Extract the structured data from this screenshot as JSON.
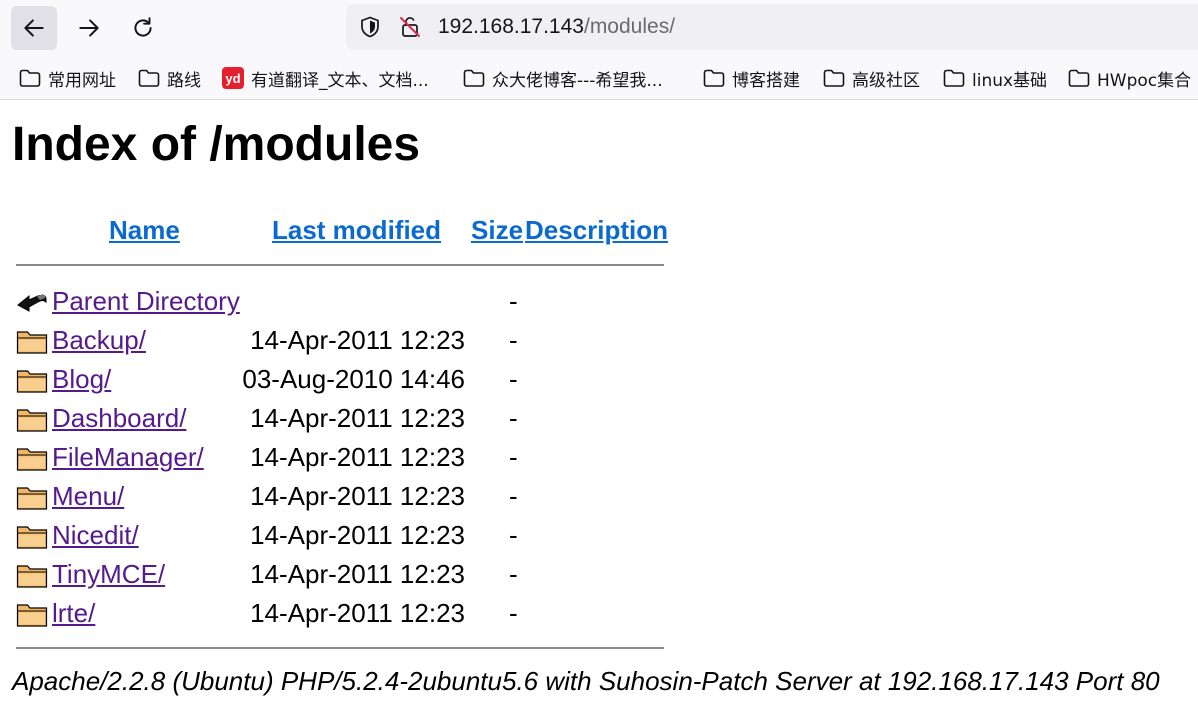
{
  "browser": {
    "url_host": "192.168.17.143",
    "url_path": "/modules/"
  },
  "bookmarks": [
    {
      "label": "常用网址",
      "icon": "folder-icon"
    },
    {
      "label": "路线",
      "icon": "folder-icon"
    },
    {
      "label": "有道翻译_文本、文档...",
      "icon": "youdao-icon",
      "icon_text": "yd",
      "icon_color": "#e3202b"
    },
    {
      "label": "众大佬博客---希望我...",
      "icon": "folder-icon"
    },
    {
      "label": "博客搭建",
      "icon": "folder-icon"
    },
    {
      "label": "高级社区",
      "icon": "folder-icon"
    },
    {
      "label": "linux基础",
      "icon": "folder-icon"
    },
    {
      "label": "HWpoc集合",
      "icon": "folder-icon"
    }
  ],
  "page": {
    "title": "Index of /modules",
    "columns": {
      "name": "Name",
      "last_modified": "Last modified",
      "size": "Size",
      "description": "Description"
    },
    "entries": [
      {
        "name": "Parent Directory",
        "date": "",
        "size": "-",
        "icon": "back-arrow-icon"
      },
      {
        "name": "Backup/",
        "date": "14-Apr-2011 12:23",
        "size": "-",
        "icon": "folder-icon"
      },
      {
        "name": "Blog/",
        "date": "03-Aug-2010 14:46",
        "size": "-",
        "icon": "folder-icon"
      },
      {
        "name": "Dashboard/",
        "date": "14-Apr-2011 12:23",
        "size": "-",
        "icon": "folder-icon"
      },
      {
        "name": "FileManager/",
        "date": "14-Apr-2011 12:23",
        "size": "-",
        "icon": "folder-icon"
      },
      {
        "name": "Menu/",
        "date": "14-Apr-2011 12:23",
        "size": "-",
        "icon": "folder-icon"
      },
      {
        "name": "Nicedit/",
        "date": "14-Apr-2011 12:23",
        "size": "-",
        "icon": "folder-icon"
      },
      {
        "name": "TinyMCE/",
        "date": "14-Apr-2011 12:23",
        "size": "-",
        "icon": "folder-icon"
      },
      {
        "name": "lrte/",
        "date": "14-Apr-2011 12:23",
        "size": "-",
        "icon": "folder-icon"
      }
    ],
    "footer": "Apache/2.2.8 (Ubuntu) PHP/5.2.4-2ubuntu5.6 with Suhosin-Patch Server at 192.168.17.143 Port 80"
  },
  "colors": {
    "header_link": "#0b6ad0",
    "visited_link": "#551a8b",
    "youdao_brand": "#e3202b"
  }
}
